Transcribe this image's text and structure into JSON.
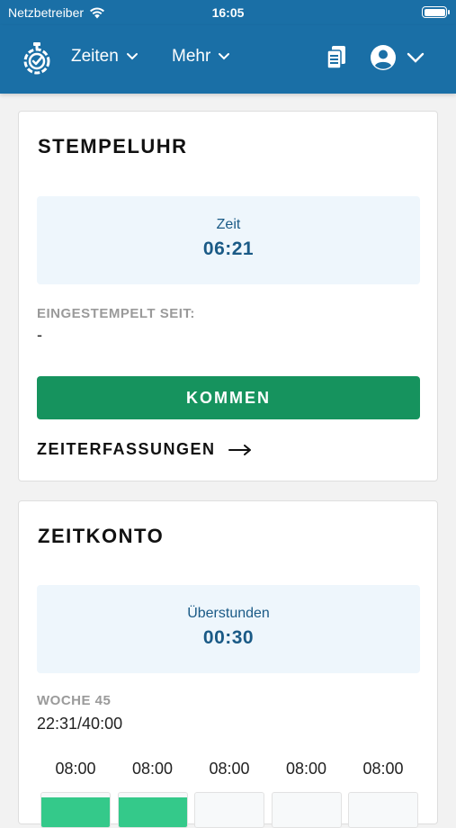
{
  "status_bar": {
    "carrier": "Netzbetreiber",
    "time": "16:05"
  },
  "header": {
    "nav": [
      {
        "label": "Zeiten"
      },
      {
        "label": "Mehr"
      }
    ]
  },
  "stempeluhr": {
    "title": "STEMPELUHR",
    "time_label": "Zeit",
    "time_value": "06:21",
    "since_label": "EINGESTEMPELT SEIT:",
    "since_value": "-",
    "button_label": "KOMMEN",
    "link_label": "ZEITERFASSUNGEN"
  },
  "zeitkonto": {
    "title": "ZEITKONTO",
    "overtime_label": "Überstunden",
    "overtime_value": "00:30",
    "week_label": "WOCHE 45",
    "week_value": "22:31/40:00",
    "days": [
      {
        "hours": "08:00",
        "filled": true
      },
      {
        "hours": "08:00",
        "filled": true
      },
      {
        "hours": "08:00",
        "filled": false
      },
      {
        "hours": "08:00",
        "filled": false
      },
      {
        "hours": "08:00",
        "filled": false
      }
    ]
  },
  "colors": {
    "header_bg": "#1a6fa6",
    "primary_button": "#16935e",
    "bar_fill": "#34c98a",
    "info_text": "#1a5a86"
  },
  "icons": [
    "wifi-icon",
    "battery-icon",
    "stopwatch-logo-icon",
    "chevron-down-icon",
    "documents-icon",
    "user-circle-icon",
    "arrow-right-icon"
  ]
}
